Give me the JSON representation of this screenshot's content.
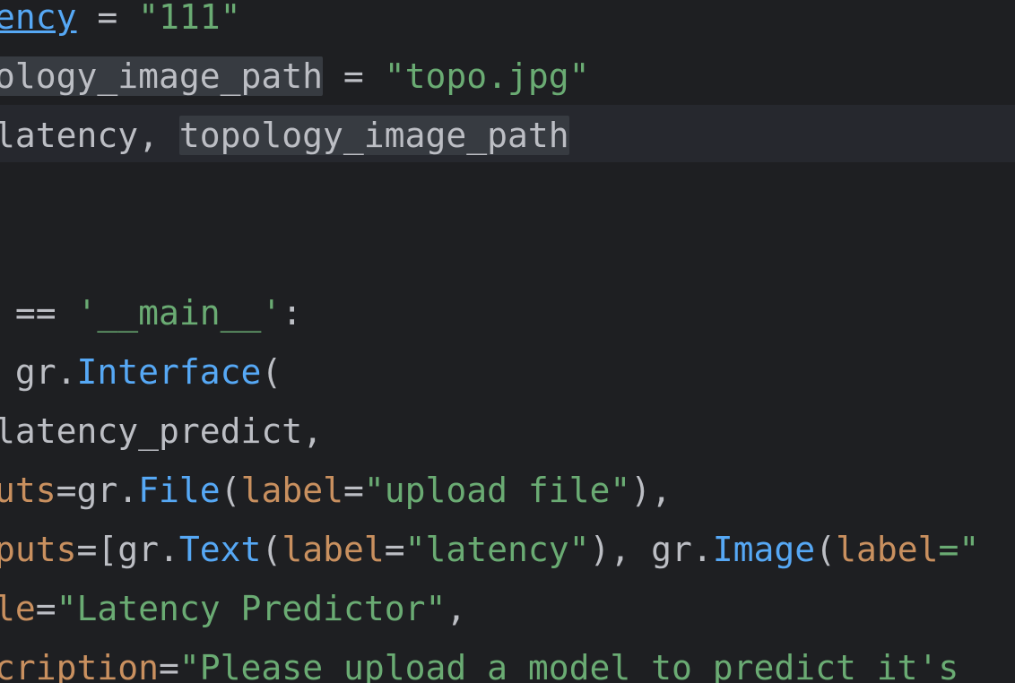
{
  "editor": {
    "colors": {
      "background": "#1e1f22",
      "current_line": "#26282e",
      "string": "#6aab73",
      "function": "#56a8f5",
      "named_param": "#c9905f",
      "default_text": "#bcbec4",
      "usage_highlight": "#373b41"
    },
    "lines": [
      {
        "tokens": [
          {
            "text": "ency",
            "style": "ul"
          },
          {
            "text": " = ",
            "style": "plain"
          },
          {
            "text": "\"111\"",
            "style": "str"
          }
        ]
      },
      {
        "tokens": [
          {
            "text": "ology_image_path",
            "style": "usage"
          },
          {
            "text": " = ",
            "style": "plain"
          },
          {
            "text": "\"topo.jpg\"",
            "style": "str"
          }
        ]
      },
      {
        "tokens": [
          {
            "text": "latency, ",
            "style": "plain"
          },
          {
            "text": "topology_image_path",
            "style": "usage"
          }
        ]
      },
      {
        "tokens": []
      },
      {
        "tokens": []
      },
      {
        "tokens": [
          {
            "text": " == ",
            "style": "plain"
          },
          {
            "text": "'__main__'",
            "style": "str"
          },
          {
            "text": ":",
            "style": "plain"
          }
        ]
      },
      {
        "tokens": [
          {
            "text": " gr.",
            "style": "plain"
          },
          {
            "text": "Interface",
            "style": "fn"
          },
          {
            "text": "(",
            "style": "plain"
          }
        ]
      },
      {
        "tokens": [
          {
            "text": "latency_predict,",
            "style": "plain"
          }
        ]
      },
      {
        "tokens": [
          {
            "text": "uts",
            "style": "param"
          },
          {
            "text": "=gr.",
            "style": "plain"
          },
          {
            "text": "File",
            "style": "fn"
          },
          {
            "text": "(",
            "style": "plain"
          },
          {
            "text": "label",
            "style": "param"
          },
          {
            "text": "=",
            "style": "plain"
          },
          {
            "text": "\"upload file\"",
            "style": "str"
          },
          {
            "text": "),",
            "style": "plain"
          }
        ]
      },
      {
        "tokens": [
          {
            "text": "puts",
            "style": "param"
          },
          {
            "text": "=[gr.",
            "style": "plain"
          },
          {
            "text": "Text",
            "style": "fn"
          },
          {
            "text": "(",
            "style": "plain"
          },
          {
            "text": "label",
            "style": "param"
          },
          {
            "text": "=",
            "style": "plain"
          },
          {
            "text": "\"latency\"",
            "style": "str"
          },
          {
            "text": "), gr.",
            "style": "plain"
          },
          {
            "text": "Image",
            "style": "fn"
          },
          {
            "text": "(",
            "style": "plain"
          },
          {
            "text": "label",
            "style": "param"
          },
          {
            "text": "=\"",
            "style": "str"
          }
        ]
      },
      {
        "tokens": [
          {
            "text": "le",
            "style": "param"
          },
          {
            "text": "=",
            "style": "plain"
          },
          {
            "text": "\"Latency Predictor\"",
            "style": "str"
          },
          {
            "text": ",",
            "style": "plain"
          }
        ]
      },
      {
        "tokens": [
          {
            "text": "cription",
            "style": "param"
          },
          {
            "text": "=",
            "style": "plain"
          },
          {
            "text": "\"Please upload a model to predict it's",
            "style": "str"
          }
        ]
      }
    ]
  }
}
